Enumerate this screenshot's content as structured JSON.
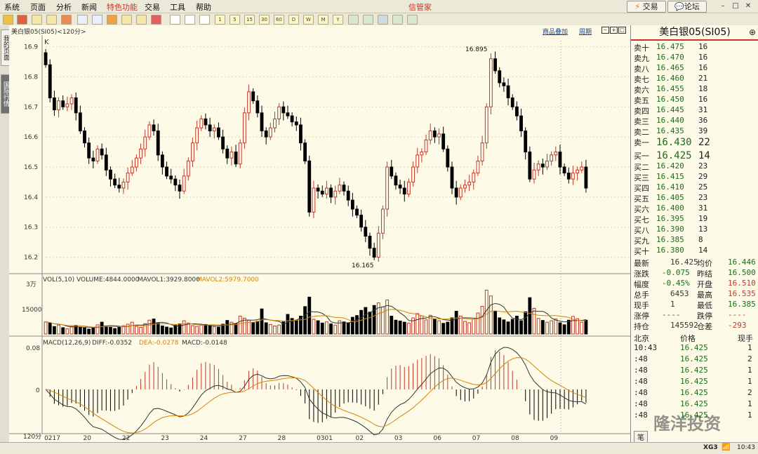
{
  "menu": {
    "items": [
      "系统",
      "页面",
      "分析",
      "新闻",
      "特色功能",
      "交易",
      "工具",
      "帮助"
    ],
    "app_title": "信管家",
    "trade_button": "交易",
    "forum_button": "论坛"
  },
  "toolbar": {
    "text_buttons": [
      "1",
      "5",
      "15",
      "30",
      "60",
      "D",
      "W",
      "M",
      "Y"
    ]
  },
  "left_tabs": {
    "personal": "我的页面",
    "international": "国际行情"
  },
  "chart": {
    "symbol": "美白银05(SI05)<120分>",
    "link_overlay": "商品叠加",
    "link_period": "周期",
    "kline_label": "K",
    "price_high": "16.895",
    "price_low": "16.165",
    "volume_legend": {
      "vol": "VOL(5,10)",
      "volume": "VOLUME:4844.0000",
      "mavol1": "MAVOL1:3929.8000",
      "mavol2": "MAVOL2:5979.7000"
    },
    "volume_ticks": [
      "3万",
      "15000"
    ],
    "macd_legend": {
      "macd": "MACD(12,26,9)",
      "diff": "DIFF:-0.0352",
      "dea": "DEA:-0.0278",
      "hist": "MACD:-0.0148"
    },
    "macd_ticks": [
      "0.08",
      "0"
    ],
    "x_labels": [
      "0217",
      "20",
      "22",
      "23",
      "24",
      "27",
      "28",
      "0301",
      "02",
      "03",
      "06",
      "07",
      "08",
      "09"
    ],
    "x_period_label": "120分",
    "colors": {
      "up": "#c0392b",
      "down": "#000000",
      "mavol1": "#333333",
      "mavol2": "#d4820a"
    }
  },
  "chart_data": {
    "type": "candlestick",
    "ylim": [
      16.15,
      16.92
    ],
    "yticks": [
      "16.9",
      "16.8",
      "16.7",
      "16.6",
      "16.5",
      "16.4",
      "16.3",
      "16.2"
    ],
    "series": [
      {
        "name": "close",
        "values": [
          16.84,
          16.73,
          16.69,
          16.72,
          16.7,
          16.71,
          16.73,
          16.68,
          16.62,
          16.58,
          16.53,
          16.52,
          16.56,
          16.54,
          16.49,
          16.46,
          16.44,
          16.43,
          16.45,
          16.48,
          16.5,
          16.53,
          16.56,
          16.6,
          16.64,
          16.62,
          16.54,
          16.5,
          16.47,
          16.46,
          16.44,
          16.42,
          16.47,
          16.52,
          16.58,
          16.63,
          16.66,
          16.64,
          16.62,
          16.63,
          16.6,
          16.56,
          16.53,
          16.55,
          16.51,
          16.58,
          16.68,
          16.75,
          16.72,
          16.68,
          16.62,
          16.6,
          16.63,
          16.66,
          16.7,
          16.68,
          16.67,
          16.65,
          16.64,
          16.58,
          16.52,
          16.35,
          16.43,
          16.42,
          16.41,
          16.43,
          16.4,
          16.42,
          16.44,
          16.42,
          16.39,
          16.36,
          16.34,
          16.3,
          16.27,
          16.23,
          16.2,
          16.28,
          16.36,
          16.5,
          16.47,
          16.44,
          16.43,
          16.41,
          16.45,
          16.5,
          16.54,
          16.55,
          16.59,
          16.62,
          16.6,
          16.61,
          16.56,
          16.5,
          16.43,
          16.4,
          16.43,
          16.44,
          16.45,
          16.48,
          16.52,
          16.58,
          16.7,
          16.86,
          16.82,
          16.78,
          16.77,
          16.73,
          16.7,
          16.67,
          16.62,
          16.55,
          16.46,
          16.49,
          16.51,
          16.5,
          16.52,
          16.54,
          16.55,
          16.5,
          16.48,
          16.46,
          16.48,
          16.49,
          16.5,
          16.43
        ]
      },
      {
        "name": "VOL(5,10)",
        "values": [
          4200,
          3800,
          2600,
          3100,
          2200,
          1800,
          2600,
          3000,
          2400,
          2100,
          1700,
          2200,
          3200,
          4100,
          2800,
          2300,
          1900,
          2500,
          2900,
          3400,
          4100,
          2700,
          2300,
          3600,
          4800,
          5200,
          3900,
          2800,
          2400,
          2100,
          3000,
          3500,
          4600,
          3800,
          2900,
          2600,
          3100,
          3300,
          2800,
          2500,
          2400,
          3400,
          4700,
          4100,
          3600,
          6200,
          5500,
          4800,
          3900,
          4400,
          8700,
          3900,
          3300,
          2800,
          3100,
          4200,
          6800,
          5400,
          4800,
          6200,
          9500,
          12800,
          5100,
          4600,
          3800,
          4200,
          3500,
          3100,
          4600,
          4200,
          3900,
          5800,
          6400,
          8200,
          9200,
          7600,
          9900,
          10800,
          9400,
          11800,
          6200,
          4800,
          4500,
          4100,
          3800,
          5600,
          7100,
          6300,
          4900,
          6500,
          5200,
          4600,
          3700,
          4100,
          5600,
          7900,
          6200,
          4400,
          3900,
          5100,
          7300,
          9600,
          15200,
          13200,
          7800,
          5600,
          4900,
          4200,
          5100,
          6200,
          4600,
          7700,
          12600,
          8900,
          5400,
          4700,
          4100,
          4600,
          5200,
          3900,
          3200,
          4800,
          6100,
          5300,
          4100,
          4800
        ]
      },
      {
        "name": "MACD(12,26,9)",
        "values": []
      }
    ]
  },
  "quote": {
    "title": "美白银05(SI05)",
    "asks": [
      [
        "卖十",
        "16.475",
        "16"
      ],
      [
        "卖九",
        "16.470",
        "16"
      ],
      [
        "卖八",
        "16.465",
        "16"
      ],
      [
        "卖七",
        "16.460",
        "21"
      ],
      [
        "卖六",
        "16.455",
        "18"
      ],
      [
        "卖五",
        "16.450",
        "16"
      ],
      [
        "卖四",
        "16.445",
        "31"
      ],
      [
        "卖三",
        "16.440",
        "36"
      ],
      [
        "卖二",
        "16.435",
        "39"
      ]
    ],
    "ask1": [
      "卖一",
      "16.430",
      "22"
    ],
    "bid1": [
      "买一",
      "16.425",
      "14"
    ],
    "bids": [
      [
        "买二",
        "16.420",
        "23"
      ],
      [
        "买三",
        "16.415",
        "29"
      ],
      [
        "买四",
        "16.410",
        "25"
      ],
      [
        "买五",
        "16.405",
        "23"
      ],
      [
        "买六",
        "16.400",
        "31"
      ],
      [
        "买七",
        "16.395",
        "19"
      ],
      [
        "买八",
        "16.390",
        "13"
      ],
      [
        "买九",
        "16.385",
        "8"
      ],
      [
        "买十",
        "16.380",
        "14"
      ]
    ],
    "stats": [
      [
        "最新",
        "16.425",
        "均价",
        "16.446"
      ],
      [
        "涨跌",
        "-0.075",
        "昨结",
        "16.500"
      ],
      [
        "幅度",
        "-0.45%",
        "开盘",
        "16.510"
      ],
      [
        "总手",
        "6453",
        "最高",
        "16.535"
      ],
      [
        "现手",
        "1",
        "最低",
        "16.385"
      ],
      [
        "涨停",
        "----",
        "跌停",
        "----"
      ],
      [
        "持仓",
        "145592",
        "仓差",
        "-293"
      ]
    ],
    "ticks_header": [
      "北京",
      "价格",
      "现手"
    ],
    "ticks": [
      [
        "10:43",
        "16.425",
        "1"
      ],
      [
        ":48",
        "16.425",
        "2"
      ],
      [
        ":48",
        "16.425",
        "1"
      ],
      [
        ":48",
        "16.425",
        "1"
      ],
      [
        ":48",
        "16.425",
        "2"
      ],
      [
        ":48",
        "16.425",
        "1"
      ],
      [
        ":48",
        "16.425",
        "1"
      ]
    ],
    "bottom_tab": "笔",
    "watermark": "隆洋投资"
  },
  "status": {
    "brand": "XG3",
    "time": "10:43"
  }
}
